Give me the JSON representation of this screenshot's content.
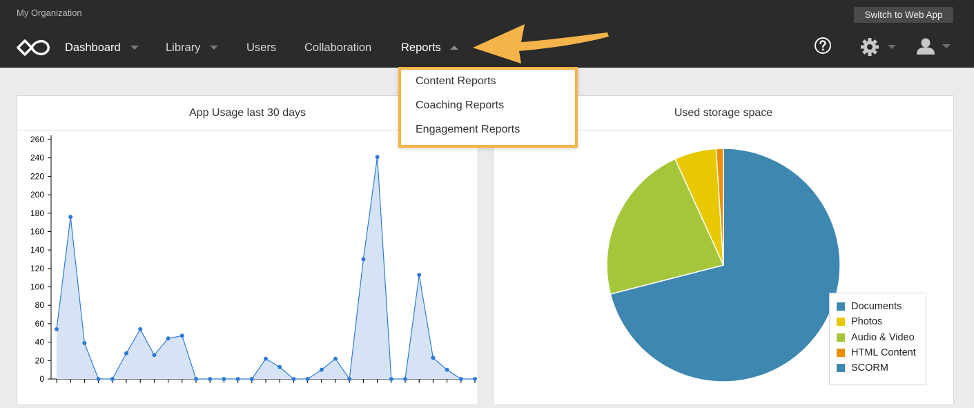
{
  "org": {
    "name": "My Organization"
  },
  "switch_button": {
    "label": "Switch to Web App"
  },
  "nav": {
    "dashboard": "Dashboard",
    "library": "Library",
    "users": "Users",
    "collaboration": "Collaboration",
    "reports": "Reports"
  },
  "reports_menu": {
    "items": [
      "Content Reports",
      "Coaching Reports",
      "Engagement Reports"
    ]
  },
  "colors": {
    "topbar": "#2b2b2b",
    "highlight": "#f4b44a",
    "line": "#2f7bd4",
    "area": "#d6e3f5"
  },
  "icons": [
    "logo-icon",
    "help-icon",
    "gear-icon",
    "user-icon",
    "arrow-pointer"
  ],
  "usage_panel": {
    "title": "App Usage last 30 days"
  },
  "storage_panel": {
    "title": "Used storage space"
  },
  "chart_data": [
    {
      "type": "area",
      "title": "App Usage last 30 days",
      "ylim": [
        0,
        260
      ],
      "yticks": [
        0,
        20,
        40,
        60,
        80,
        100,
        120,
        140,
        160,
        180,
        200,
        220,
        240,
        260
      ],
      "values": [
        54,
        176,
        39,
        0,
        0,
        28,
        54,
        26,
        44,
        47,
        0,
        0,
        0,
        0,
        0,
        22,
        13,
        0,
        0,
        10,
        22,
        0,
        130,
        241,
        0,
        0,
        113,
        23,
        10,
        0,
        0
      ],
      "grid": false
    },
    {
      "type": "pie",
      "title": "Used storage space",
      "legend_position": "bottom-right",
      "slices": [
        {
          "name": "Documents",
          "value": 71,
          "color": "#3d87b0"
        },
        {
          "name": "Photos",
          "value": 5.8,
          "color": "#e8c800"
        },
        {
          "name": "Audio & Video",
          "value": 22.2,
          "color": "#a5c63b"
        },
        {
          "name": "HTML Content",
          "value": 1.0,
          "color": "#eb8f00"
        },
        {
          "name": "SCORM",
          "value": 0,
          "color": "#3d87b0"
        }
      ]
    }
  ]
}
